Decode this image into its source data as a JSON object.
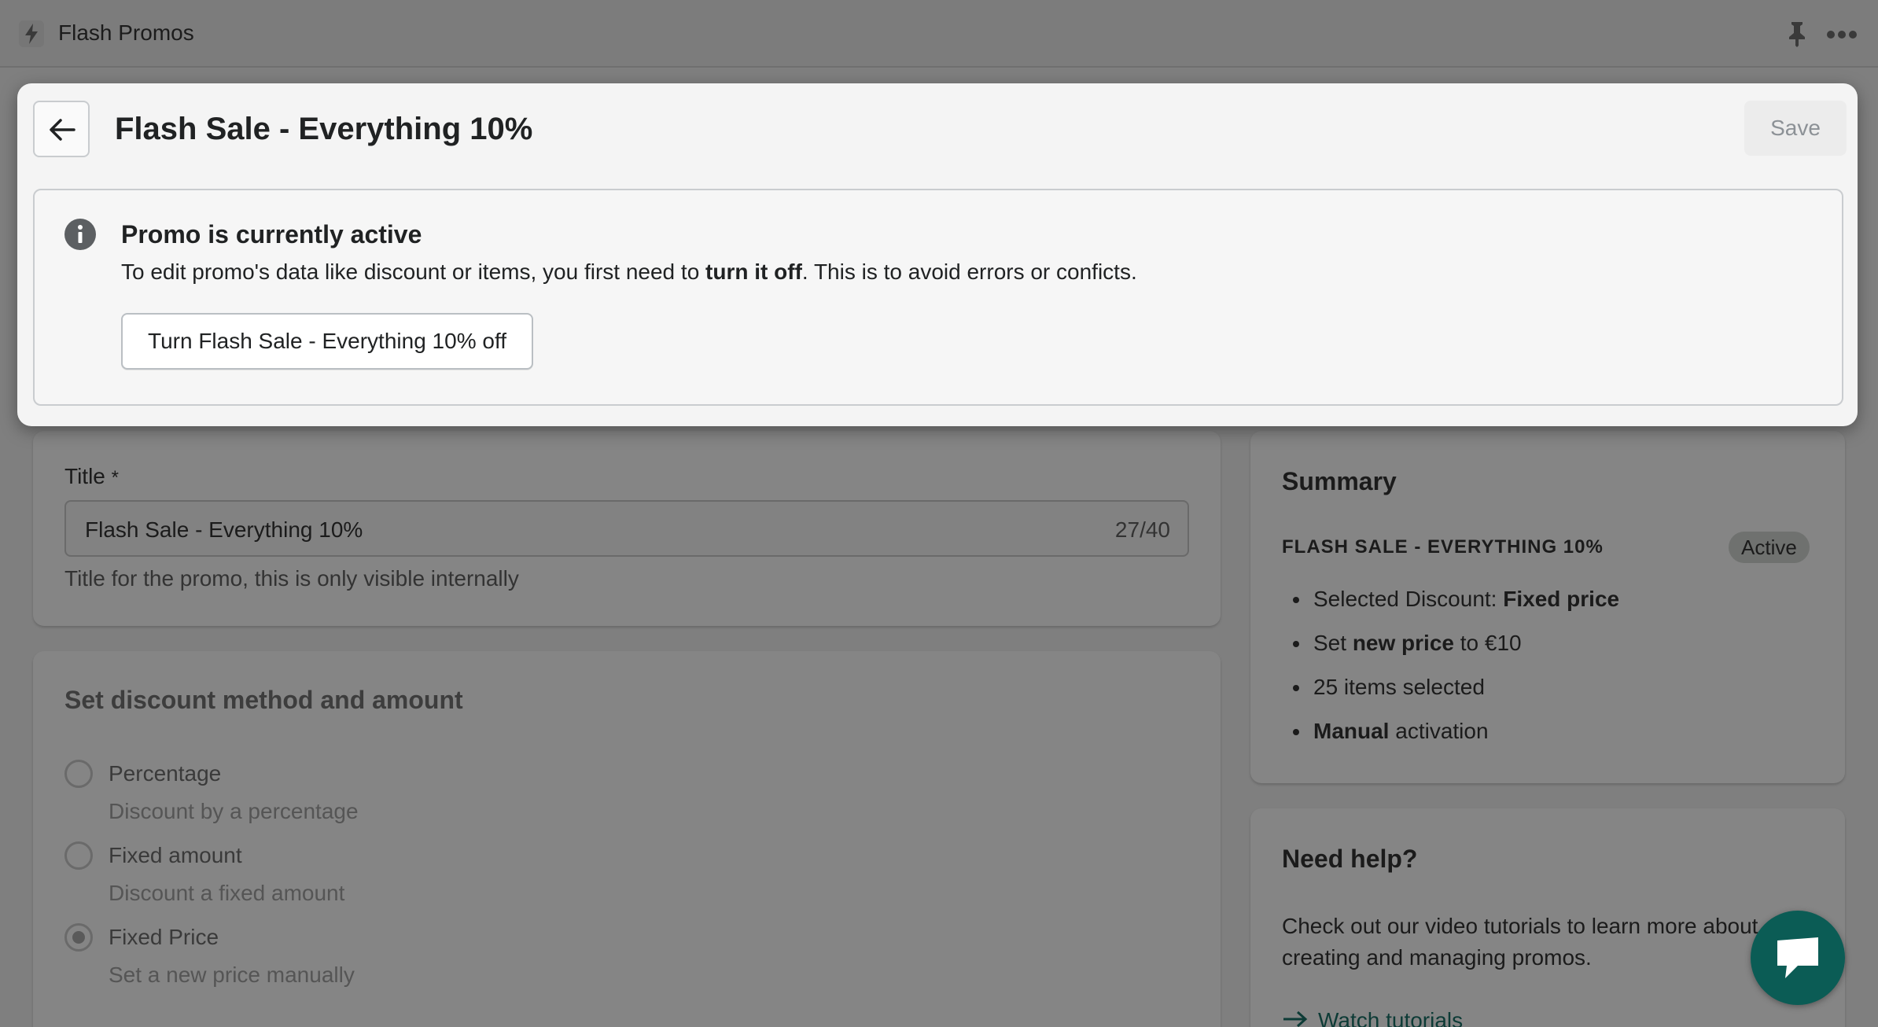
{
  "app": {
    "title": "Flash Promos"
  },
  "modal": {
    "title": "Flash Sale - Everything 10%",
    "save_label": "Save",
    "banner": {
      "heading": "Promo is currently active",
      "text_before": "To edit promo's data like discount or items, you first need to ",
      "text_bold": "turn it off",
      "text_after": ". This is to avoid errors or conficts.",
      "button_label": "Turn Flash Sale - Everything 10% off"
    }
  },
  "title_card": {
    "label": "Title",
    "required_mark": "*",
    "value": "Flash Sale - Everything 10%",
    "counter": "27/40",
    "help": "Title for the promo, this is only visible internally"
  },
  "discount_card": {
    "heading": "Set discount method and amount",
    "options": [
      {
        "label": "Percentage",
        "description": "Discount by a percentage",
        "selected": false
      },
      {
        "label": "Fixed amount",
        "description": "Discount a fixed amount",
        "selected": false
      },
      {
        "label": "Fixed Price",
        "description": "Set a new price manually",
        "selected": true
      }
    ]
  },
  "summary": {
    "heading": "Summary",
    "promo_name": "FLASH SALE - EVERYTHING 10%",
    "status_badge": "Active",
    "items": [
      {
        "pre": "Selected Discount: ",
        "bold": "Fixed price",
        "post": ""
      },
      {
        "pre": "Set ",
        "bold": "new price",
        "post": " to €10"
      },
      {
        "pre": "25 items selected",
        "bold": "",
        "post": ""
      },
      {
        "pre": "",
        "bold": "Manual",
        "post": " activation"
      }
    ]
  },
  "help": {
    "heading": "Need help?",
    "text": "Check out our video tutorials to learn more about creating and managing promos.",
    "link_label": "Watch tutorials"
  },
  "colors": {
    "overlay": "#7f7f7f",
    "modal_bg": "#f4f4f4",
    "chat_button": "#0b5c55",
    "link": "#0d3b36"
  }
}
